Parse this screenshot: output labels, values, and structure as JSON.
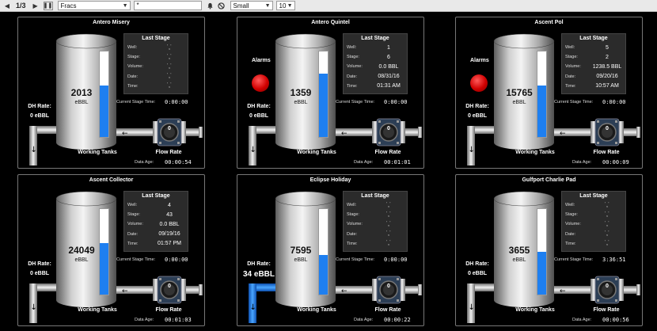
{
  "toolbar": {
    "page_indicator": "1/3",
    "view_select": "Fracs",
    "filter_value": "*",
    "size_select": "Small",
    "count_select": "10"
  },
  "labels": {
    "last_stage": "Last Stage",
    "well": "Well:",
    "stage": "Stage:",
    "volume": "Volume:",
    "date": "Date:",
    "time": "Time:",
    "current_stage_time": "Current Stage Time:",
    "dh_rate": "DH Rate:",
    "alarms": "Alarms",
    "working_tanks": "Working Tanks",
    "flow_rate": "Flow Rate",
    "data_age": "Data Age:",
    "tank_unit": "eBBL",
    "gauge_value": "0"
  },
  "colors": {
    "level": "#1e7ff0",
    "alarm": "#e00000",
    "active_pipe": "#1e7ff0"
  },
  "panels": [
    {
      "title": "Antero Misery",
      "tank_value": "2013",
      "level": 0.6,
      "alarm": false,
      "well": "˙,˙",
      "stage": "˙,˙",
      "volume": "˙,˙",
      "date": "˙,˙",
      "time": "˙,˙",
      "current_stage_time": "0:00:00",
      "dh_rate": "0 eBBL",
      "dh_active": false,
      "data_age": "00:00:54"
    },
    {
      "title": "Antero Quintel",
      "tank_value": "1359",
      "level": 0.74,
      "alarm": true,
      "well": "1",
      "stage": "6",
      "volume": "0.0  BBL",
      "date": "08/31/16",
      "time": "01:31 AM",
      "current_stage_time": "0:00:00",
      "dh_rate": "0 eBBL",
      "dh_active": false,
      "data_age": "00:01:01"
    },
    {
      "title": "Ascent Pol",
      "tank_value": "15765",
      "level": 0.6,
      "alarm": true,
      "well": "5",
      "stage": "2",
      "volume": "1238.5  BBL",
      "date": "09/20/16",
      "time": "10:57 AM",
      "current_stage_time": "0:00:00",
      "dh_rate": "0 eBBL",
      "dh_active": false,
      "data_age": "00:00:09"
    },
    {
      "title": "Ascent Collector",
      "tank_value": "24049",
      "level": 0.6,
      "alarm": false,
      "well": "4",
      "stage": "43",
      "volume": "0.0  BBL",
      "date": "09/19/16",
      "time": "01:57 PM",
      "current_stage_time": "0:00:00",
      "dh_rate": "0 eBBL",
      "dh_active": false,
      "data_age": "00:01:03"
    },
    {
      "title": "Eclipse Holiday",
      "tank_value": "7595",
      "level": 0.46,
      "alarm": false,
      "well": "˙,˙",
      "stage": "˙,˙",
      "volume": "˙,˙",
      "date": "˙,˙",
      "time": "˙,˙",
      "current_stage_time": "0:00:00",
      "dh_rate": "34 eBBL",
      "dh_active": true,
      "data_age": "00:00:22"
    },
    {
      "title": "Gulfport Charlie Pad",
      "tank_value": "3655",
      "level": 0.5,
      "alarm": false,
      "well": "˙,˙",
      "stage": "˙,˙",
      "volume": "˙,˙",
      "date": "˙,˙",
      "time": "˙,˙",
      "current_stage_time": "3:36:51",
      "dh_rate": "0 eBBL",
      "dh_active": false,
      "data_age": "00:00:56"
    }
  ]
}
